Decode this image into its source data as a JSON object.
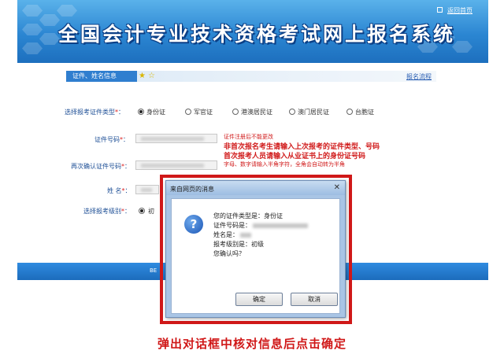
{
  "header": {
    "title": "全国会计专业技术资格考试网上报名系统",
    "back_link": "返回首页"
  },
  "section": {
    "tab_label": "证件、姓名信息",
    "flow_link": "报名流程"
  },
  "form": {
    "id_type_label": "选择报考证件类型",
    "id_number_label": "证件号码",
    "id_confirm_label": "再次确认证件号码",
    "name_label": "姓  名",
    "level_label": "选择报考级别",
    "required_mark": "*",
    "id_types": [
      {
        "label": "身份证",
        "selected": true
      },
      {
        "label": "军官证",
        "selected": false
      },
      {
        "label": "港澳居民证",
        "selected": false
      },
      {
        "label": "澳门居民证",
        "selected": false
      },
      {
        "label": "台胞证",
        "selected": false
      }
    ],
    "level_option": "初",
    "note_small": "证件注册后不能更改",
    "note_big_1": "非首次报名考生请输入上次报考的证件类型、号码",
    "note_big_2": "首次报考人员请输入从业证书上的身份证号码",
    "note_small_2": "字母、数字请输入半角字符，全角会自动转为半角"
  },
  "footer": {
    "text": "BE"
  },
  "dialog": {
    "title": "来自网页的消息",
    "close_glyph": "✕",
    "icon_glyph": "?",
    "lines": {
      "id_type": "您的证件类型是：身份证",
      "id_number": "证件号码是：",
      "name": "姓名是：",
      "level": "报考级别是：初级",
      "confirm": "您确认吗？"
    },
    "ok_label": "确定",
    "cancel_label": "取消"
  },
  "caption": "弹出对话框中核对信息后点击确定",
  "colors": {
    "banner": "#2b86d2",
    "highlight_red": "#d01818",
    "label_blue": "#1e4f96"
  }
}
